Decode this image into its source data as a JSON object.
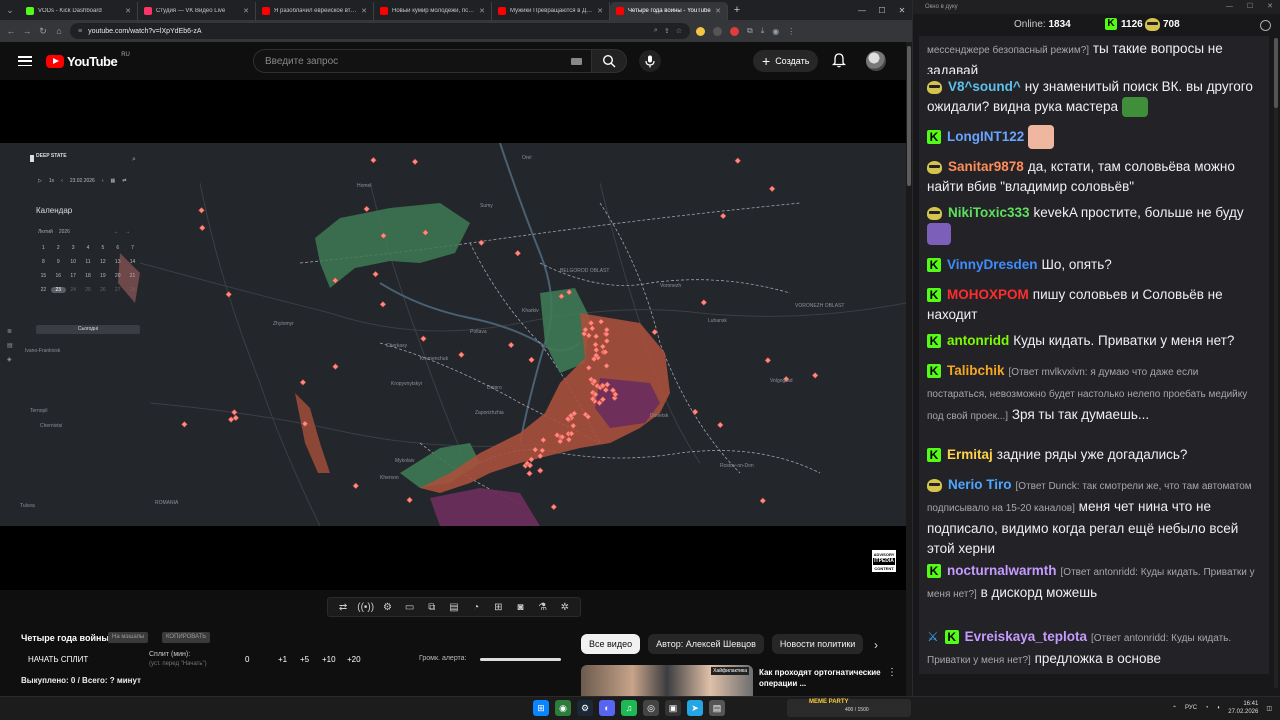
{
  "browser": {
    "tabs": [
      {
        "title": "VODs - Kick Dashboard",
        "color": "#53fc18"
      },
      {
        "title": "Студия — VK Видео Live",
        "color": "#ff3366"
      },
      {
        "title": "Я разоблачил еврейское втор...",
        "color": "#ff0000"
      },
      {
        "title": "Новый кумир молодежи, псих...",
        "color": "#ff0000"
      },
      {
        "title": "Мужики Превращаются в ДЕВ...",
        "color": "#ff0000"
      },
      {
        "title": "Четыре года войны - YouTube",
        "color": "#ff0000",
        "active": true
      }
    ],
    "url": "youtube.com/watch?v=lXpYdEb6-zA"
  },
  "youtube": {
    "logo_text": "YouTube",
    "logo_region": "RU",
    "search_placeholder": "Введите запрос",
    "create_label": "Создать"
  },
  "map": {
    "brand": "DEEP STATE",
    "date": "23.02.2026",
    "speed": "1х",
    "calendar_title": "Календар",
    "month": "Лютий",
    "year": "2026",
    "days": [
      "1",
      "2",
      "3",
      "4",
      "5",
      "6",
      "7",
      "8",
      "9",
      "10",
      "11",
      "12",
      "13",
      "14",
      "15",
      "16",
      "17",
      "18",
      "19",
      "20",
      "21",
      "22",
      "23",
      "24",
      "25",
      "26",
      "27",
      "28"
    ],
    "today_label": "Сьогодні",
    "labels": [
      {
        "text": "Orel"
      },
      {
        "text": "Homel"
      },
      {
        "text": "Sumy"
      },
      {
        "text": "Zhytomyr"
      },
      {
        "text": "Kharkiv"
      },
      {
        "text": "Poltava"
      },
      {
        "text": "Cherkasy"
      },
      {
        "text": "Kremenchuk"
      },
      {
        "text": "Kropyvnytskyi"
      },
      {
        "text": "Dnipro"
      },
      {
        "text": "Zaporizhzhia"
      },
      {
        "text": "Luhansk"
      },
      {
        "text": "Donetsk"
      },
      {
        "text": "Mykolaiv"
      },
      {
        "text": "Kherson"
      },
      {
        "text": "Volgograd"
      },
      {
        "text": "Rostov-on-Don"
      },
      {
        "text": "Tulcea"
      },
      {
        "text": "ROMANIA"
      },
      {
        "text": "Ivano-Frankivsk"
      },
      {
        "text": "Chernivtsi"
      },
      {
        "text": "Ternopil"
      },
      {
        "text": "Voronezh"
      },
      {
        "text": "BELGOROD OBLAST"
      },
      {
        "text": "VORONEZH OBLAST"
      }
    ],
    "advisory_top": "ADVISORY",
    "advisory_mid": "ITPEDIA",
    "advisory_bot": "CONTENT"
  },
  "controls": [
    "loop-icon",
    "broadcast-icon",
    "settings-panel-icon",
    "clip-icon",
    "pip-icon",
    "subtitles-icon",
    "speed-icon",
    "screenshot-icon",
    "camera-icon",
    "flask-icon",
    "gear-icon"
  ],
  "panel": {
    "title": "Четыре года войны",
    "tag1": "На мэшапы",
    "tag2": "КОПИРОВАТЬ",
    "split_button": "НАЧАТЬ СПЛИТ",
    "split_label": "Сплит (мин):",
    "split_hint": "(уст. перед \"Начать\")",
    "zero": "0",
    "steps": [
      "+1",
      "+5",
      "+10",
      "+20"
    ],
    "alert_label": "Громк. алерта:",
    "bought": "Выкуплено: 0 / Всего: ? минут"
  },
  "chips": [
    "Все видео",
    "Автор: Алексей Шевцов",
    "Новости политики"
  ],
  "recommendation": {
    "title": "Как проходят ортогнатические операции ...",
    "thumb_tag": "Хайфилактика"
  },
  "chat": {
    "window_title": "Окно в дуку",
    "online_label": "Online:",
    "online_count": "1834",
    "kick_count": "1126",
    "twitch_count": "708",
    "messages": [
      {
        "badge": "",
        "user": "",
        "color": "#fff",
        "reply": "мессенджере безопасный режим?]",
        "text": "ты такие вопросы не задавай"
      },
      {
        "badge": "face",
        "user": "V8^sound^",
        "color": "#5bc0eb",
        "reply": "",
        "text": "ну знаменитый поиск ВК. вы другого ожидали? видна рука мастера"
      },
      {
        "badge": "kick",
        "user": "LongINT122",
        "color": "#6aa3ff",
        "reply": "",
        "text": ""
      },
      {
        "badge": "face",
        "user": "Sanitar9878",
        "color": "#ff8c5a",
        "reply": "",
        "text": "да, кстати, там соловьёва можно найти вбив \"владимир соловьёв\""
      },
      {
        "badge": "face",
        "user": "NikiToxic333",
        "color": "#5ee05e",
        "reply": "",
        "text": "kevekA простите, больше не буду"
      },
      {
        "badge": "kick",
        "user": "VinnyDresden",
        "color": "#3f8cff",
        "reply": "",
        "text": "Шо, опять?"
      },
      {
        "badge": "kick",
        "user": "MOHOXPOM",
        "color": "#ff2d2d",
        "reply": "",
        "text": "пишу соловьев и Соловьёв не находит"
      },
      {
        "badge": "kick",
        "user": "antonridd",
        "color": "#7cfc00",
        "reply": "",
        "text": "Куды кидать. Приватки у меня нет?"
      },
      {
        "badge": "kick",
        "user": "Talibchik",
        "color": "#f5a623",
        "reply": "[Ответ mvlkvxivn: я думаю что даже если постараться, невозможно будет настолько нелепо проебать медийку под свой проек...]",
        "text": "Зря ты так думаешь..."
      },
      {
        "badge": "kick",
        "user": "Ermitaj",
        "color": "#ffd24a",
        "reply": "",
        "text": "задние ряды уже догадались?"
      },
      {
        "badge": "face",
        "user": "Nerio Tiro",
        "color": "#4da6ff",
        "reply": "[Ответ Dunck: так смотрели же, что там автоматом подписывало на 15-20 каналов]",
        "text": "меня чет нина что не подписало, видимо когда регал ещё небыло всей этой херни"
      },
      {
        "badge": "kick",
        "user": "nocturnalwarmth",
        "color": "#c59bff",
        "reply": "[Ответ antonridd: Куды кидать. Приватки у меня нет?]",
        "text": "в дискорд можешь"
      },
      {
        "badge": "sword",
        "user": "Evreiskaya_teplota",
        "color": "#c59bff",
        "reply": "[Ответ antonridd: Куды кидать. Приватки у меня нет?]",
        "text": "предложка в основе"
      }
    ]
  },
  "taskbar": {
    "meme_title": "МЕМЕ PARTY",
    "meme_count": "400 / 1500",
    "lang": "РУС",
    "time": "16:41",
    "date": "27.02.2026"
  },
  "colors": {
    "map_bg": "#23262b",
    "occupied": "#a8503b",
    "liberated": "#3e7a55",
    "crimea_occupied": "#6b2d5c",
    "strike": "#ff8a80",
    "kick_green": "#53fc18",
    "yt_red": "#ff0000"
  }
}
